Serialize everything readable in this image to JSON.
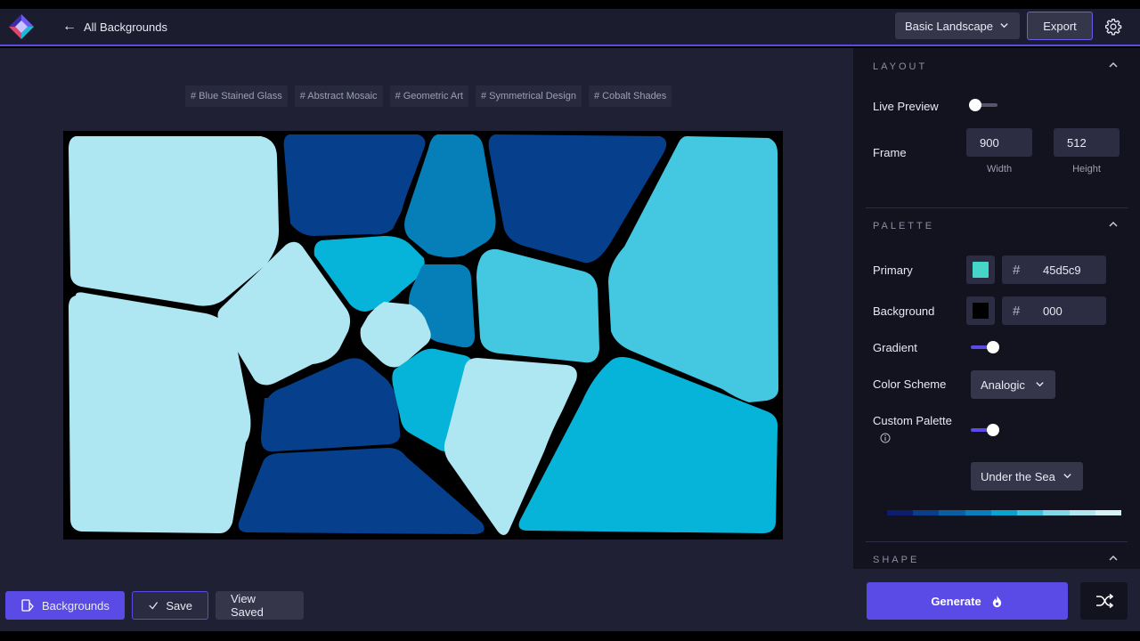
{
  "header": {
    "back_label": "All Backgrounds",
    "preset": "Basic Landscape",
    "export_label": "Export",
    "accent": "#5b4be6"
  },
  "tags": [
    "# Blue Stained Glass",
    "# Abstract Mosaic",
    "# Geometric Art",
    "# Symmetrical Design",
    "# Cobalt Shades"
  ],
  "bottom_bar": {
    "backgrounds_label": "Backgrounds",
    "save_label": "Save",
    "view_saved_label": "View Saved"
  },
  "sidebar": {
    "layout": {
      "title": "LAYOUT",
      "live_preview_label": "Live Preview",
      "live_preview_on": false,
      "frame_label": "Frame",
      "width_value": "900",
      "width_label": "Width",
      "height_value": "512",
      "height_label": "Height"
    },
    "palette": {
      "title": "PALETTE",
      "primary_label": "Primary",
      "primary_hex": "45d5c9",
      "primary_color": "#45d5c9",
      "background_label": "Background",
      "background_hex": "000",
      "background_color": "#000000",
      "gradient_label": "Gradient",
      "gradient_on": true,
      "color_scheme_label": "Color Scheme",
      "color_scheme_value": "Analogic",
      "custom_palette_label": "Custom Palette",
      "custom_palette_on": true,
      "palette_name": "Under the Sea",
      "palette_colors": [
        "#0b1d6b",
        "#0a3d8a",
        "#0a5fa3",
        "#0a7dbb",
        "#0aa2cf",
        "#3cc2dd",
        "#7fd7e8",
        "#b0e6f0",
        "#d6f2f6"
      ]
    },
    "shape": {
      "title": "SHAPE"
    },
    "generate_label": "Generate"
  },
  "mosaic": {
    "colors": {
      "light": "#aee6f2",
      "navy": "#063f8b",
      "mid": "#067fb9",
      "cyan": "#05b4d8",
      "sky": "#44c7e1"
    }
  }
}
